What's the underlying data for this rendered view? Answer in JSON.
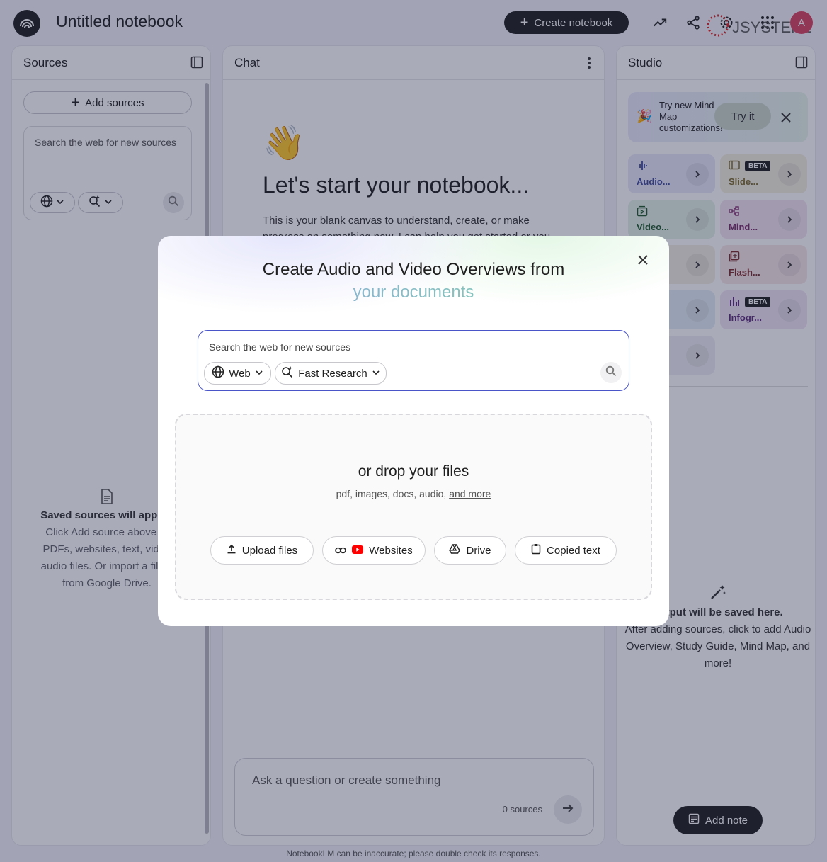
{
  "header": {
    "notebook_title": "Untitled notebook",
    "create_label": "Create notebook",
    "brand_text": "JSYSTEMS",
    "avatar_letter": "A"
  },
  "sources": {
    "title": "Sources",
    "add_label": "Add sources",
    "search_placeholder": "Search the web for new sources",
    "empty_title": "Saved sources will appear",
    "empty_lines": [
      "Click Add source above to",
      "PDFs, websites, text, video",
      "audio files. Or import a file d",
      "from Google Drive."
    ]
  },
  "chat": {
    "title": "Chat",
    "wave": "👋",
    "heading": "Let's start your notebook...",
    "intro": "This is your blank canvas to understand, create, or make progress on something new. I can help you get started or you can go ahead",
    "ask_placeholder": "Ask a question or create something",
    "sources_count": "0 sources"
  },
  "studio": {
    "title": "Studio",
    "tip_emoji": "🎉",
    "tip_text": "Try new Mind Map customizations!",
    "tip_button": "Try it",
    "cards": [
      {
        "label": "Audio...",
        "beta": "",
        "color": "#e6e8f7",
        "text_color": "#3e4a9a"
      },
      {
        "label": "Slide...",
        "beta": "BETA",
        "color": "#f3f0df",
        "text_color": "#7a6a2a"
      },
      {
        "label": "Video...",
        "beta": "",
        "color": "#e3f1e5",
        "text_color": "#1e5a2c"
      },
      {
        "label": "Mind...",
        "beta": "",
        "color": "#f2e6f0",
        "text_color": "#7a2a6a"
      },
      {
        "label": "",
        "beta": "",
        "color": "#f3efe3",
        "text_color": "#7a6a2a"
      },
      {
        "label": "Flash...",
        "beta": "",
        "color": "#f6e7e6",
        "text_color": "#7a2a2a"
      },
      {
        "label": "",
        "beta": "",
        "color": "#e3eff5",
        "text_color": "#1e4a6a"
      },
      {
        "label": "Infogr...",
        "beta": "BETA",
        "color": "#efe6f3",
        "text_color": "#5a2a7a"
      },
      {
        "label": "",
        "beta": "",
        "color": "#eeeef3",
        "text_color": "#3a3a4a"
      }
    ],
    "empty_title": "output will be saved here.",
    "empty_lines": [
      "After adding sources, click to add Audio",
      "Overview, Study Guide, Mind Map, and",
      "more!"
    ],
    "add_note_label": "Add note"
  },
  "footer": "NotebookLM can be inaccurate; please double check its responses.",
  "modal": {
    "title_line1": "Create Audio and Video Overviews from",
    "title_line2": "your documents",
    "search_placeholder": "Search the web for new sources",
    "web_label": "Web",
    "research_label": "Fast Research",
    "drop_title": "or drop your files",
    "drop_sub": "pdf, images, docs, audio,",
    "drop_more": "and more",
    "buttons": [
      "Upload files",
      "Websites",
      "Drive",
      "Copied text"
    ]
  }
}
